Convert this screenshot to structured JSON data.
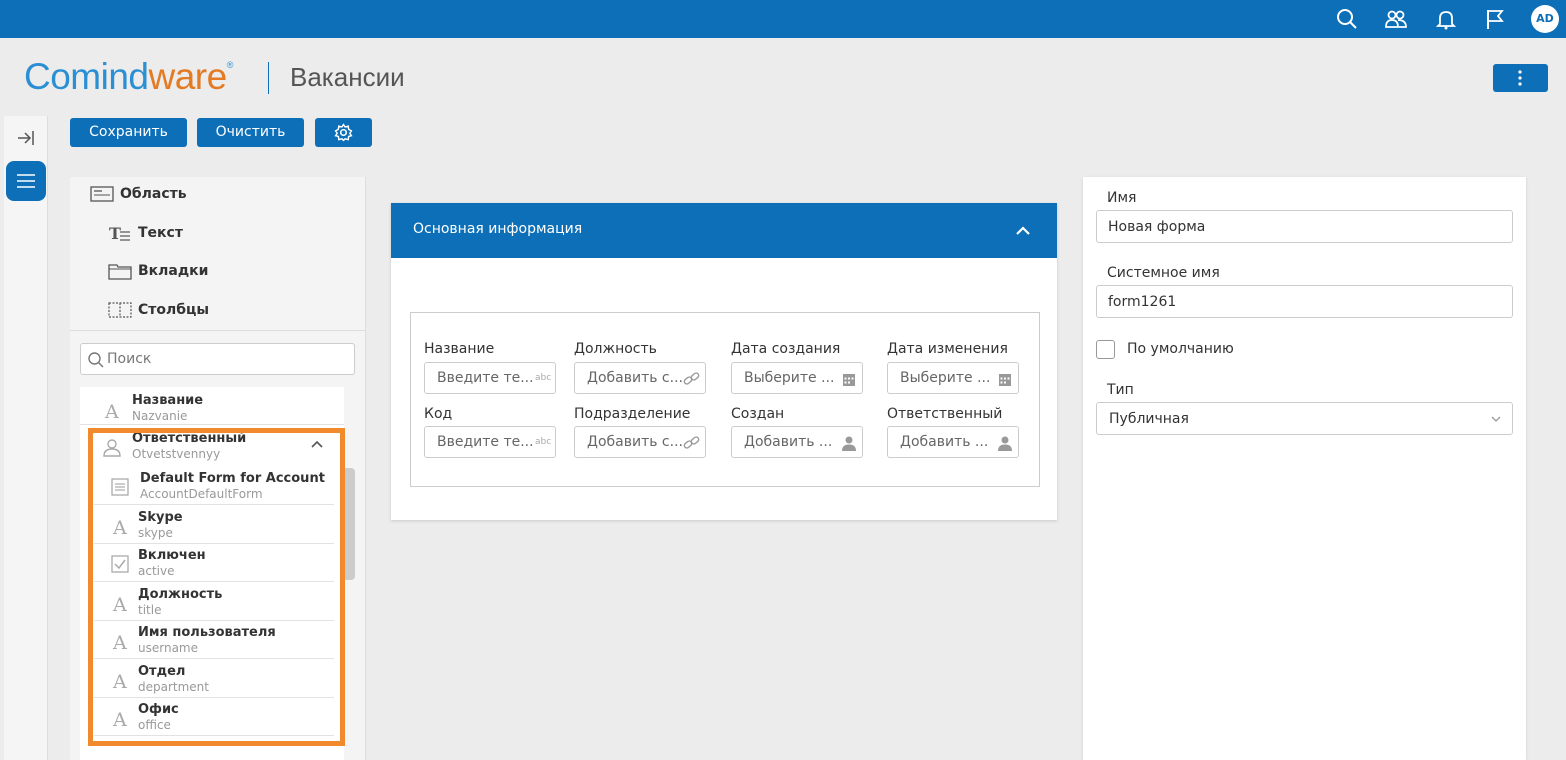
{
  "app": {
    "logo_part1": "Comind",
    "logo_part2": "ware",
    "logo_mark": "®",
    "page_title": "Вакансии",
    "avatar_initials": "AD",
    "colors": {
      "primary": "#0d6fb8",
      "logo_blue": "#2b8fd3",
      "logo_orange": "#e37a24",
      "highlight": "#f08a2c"
    }
  },
  "topbar": {
    "icons": [
      "search-icon",
      "users-icon",
      "bell-icon",
      "flag-icon"
    ]
  },
  "toolbar": {
    "save_label": "Сохранить",
    "clear_label": "Очистить",
    "settings_icon": "gear-icon"
  },
  "elements_panel": {
    "items": [
      {
        "label": "Область",
        "icon": "area-icon"
      },
      {
        "label": "Текст",
        "icon": "text-icon"
      },
      {
        "label": "Вкладки",
        "icon": "tabs-icon"
      },
      {
        "label": "Столбцы",
        "icon": "columns-icon"
      }
    ],
    "search_placeholder": "Поиск"
  },
  "field_list": {
    "top_items": [
      {
        "name": "Название",
        "system": "Nazvanie",
        "icon": "text-field-icon"
      },
      {
        "name": "Ответственный",
        "system": "Otvetstvennyy",
        "icon": "user-icon"
      }
    ],
    "children": [
      {
        "name": "Default Form for Account",
        "system": "AccountDefaultForm",
        "icon": "form-icon"
      },
      {
        "name": "Skype",
        "system": "skype",
        "icon": "text-field-icon"
      },
      {
        "name": "Включен",
        "system": "active",
        "icon": "checkbox-icon"
      },
      {
        "name": "Должность",
        "system": "title",
        "icon": "text-field-icon"
      },
      {
        "name": "Имя пользователя",
        "system": "username",
        "icon": "text-field-icon"
      },
      {
        "name": "Отдел",
        "system": "department",
        "icon": "text-field-icon"
      },
      {
        "name": "Офис",
        "system": "office",
        "icon": "text-field-icon"
      }
    ]
  },
  "form_card": {
    "title": "Основная информация",
    "fields": [
      {
        "label": "Название",
        "placeholder": "Введите те...",
        "icon": "abc-icon"
      },
      {
        "label": "Должность",
        "placeholder": "Добавить с...",
        "icon": "link-icon"
      },
      {
        "label": "Дата создания",
        "placeholder": "Выберите ...",
        "icon": "calendar-icon"
      },
      {
        "label": "Дата изменения",
        "placeholder": "Выберите ...",
        "icon": "calendar-icon"
      },
      {
        "label": "Код",
        "placeholder": "Введите те...",
        "icon": "abc-icon"
      },
      {
        "label": "Подразделение",
        "placeholder": "Добавить с...",
        "icon": "link-icon"
      },
      {
        "label": "Создан",
        "placeholder": "Добавить ...",
        "icon": "person-icon"
      },
      {
        "label": "Ответственный",
        "placeholder": "Добавить ...",
        "icon": "person-icon"
      }
    ],
    "abc_text": "abc"
  },
  "properties": {
    "name_label": "Имя",
    "name_value": "Новая форма",
    "system_name_label": "Системное имя",
    "system_name_value": "form1261",
    "default_label": "По умолчанию",
    "type_label": "Тип",
    "type_value": "Публичная"
  }
}
